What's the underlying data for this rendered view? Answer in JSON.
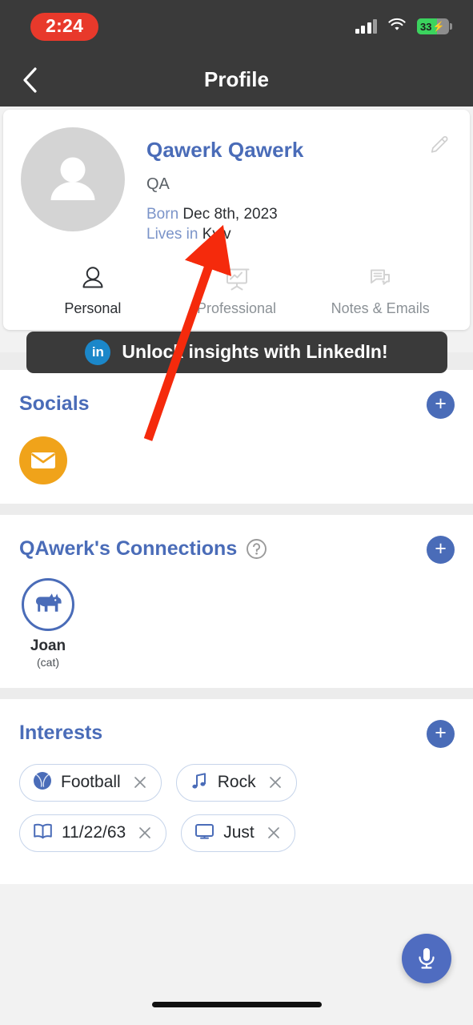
{
  "status_bar": {
    "recording_time": "2:24",
    "battery_level": "33",
    "charging_glyph": "⚡",
    "signal_icon": "cellular-signal-icon",
    "wifi_icon": "wifi-icon",
    "battery_icon": "battery-charging-icon",
    "accent_recording": "#e8392b",
    "accent_battery": "#3bd35e"
  },
  "header": {
    "title": "Profile",
    "back_icon": "chevron-left-icon",
    "background": "#3a3a3a"
  },
  "profile": {
    "name": "Qawerk Qawerk",
    "role": "QA",
    "born_label": "Born",
    "born_value": "Dec 8th, 2023",
    "lives_label": "Lives in",
    "lives_value": "Kyiv",
    "avatar_icon": "person-avatar-icon",
    "edit_icon": "pencil-edit-icon",
    "name_color": "#4a6cb8"
  },
  "tabs": [
    {
      "label": "Personal",
      "icon": "person-icon",
      "active": true
    },
    {
      "label": "Professional",
      "icon": "presentation-chart-icon",
      "active": false
    },
    {
      "label": "Notes & Emails",
      "icon": "chat-bubbles-icon",
      "active": false
    }
  ],
  "linkedin_banner": {
    "badge": "in",
    "text": "Unlock insights with LinkedIn!",
    "badge_color": "#1b87c9",
    "background": "#3a3a3a"
  },
  "socials": {
    "title": "Socials",
    "add_icon": "plus-icon",
    "items": [
      {
        "name": "email",
        "icon": "envelope-icon",
        "color": "#f0a31a"
      }
    ]
  },
  "connections": {
    "title": "QAwerk's Connections",
    "help_icon": "question-mark-circle-icon",
    "add_icon": "plus-icon",
    "items": [
      {
        "name": "Joan",
        "relation": "(cat)",
        "icon": "dog-icon"
      }
    ]
  },
  "interests": {
    "title": "Interests",
    "add_icon": "plus-icon",
    "chips": [
      {
        "label": "Football",
        "icon": "ball-icon",
        "remove_icon": "close-icon"
      },
      {
        "label": "Rock",
        "icon": "music-note-icon",
        "remove_icon": "close-icon"
      },
      {
        "label": "11/22/63",
        "icon": "book-icon",
        "remove_icon": "close-icon"
      },
      {
        "label": "Just",
        "icon": "monitor-icon",
        "remove_icon": "close-icon"
      }
    ]
  },
  "fab": {
    "icon": "microphone-icon",
    "color": "#4f6cc0"
  },
  "annotation": {
    "type": "arrow",
    "color": "#f52a0c",
    "points_to": "Lives in Kyiv"
  },
  "home_indicator": "home-indicator"
}
